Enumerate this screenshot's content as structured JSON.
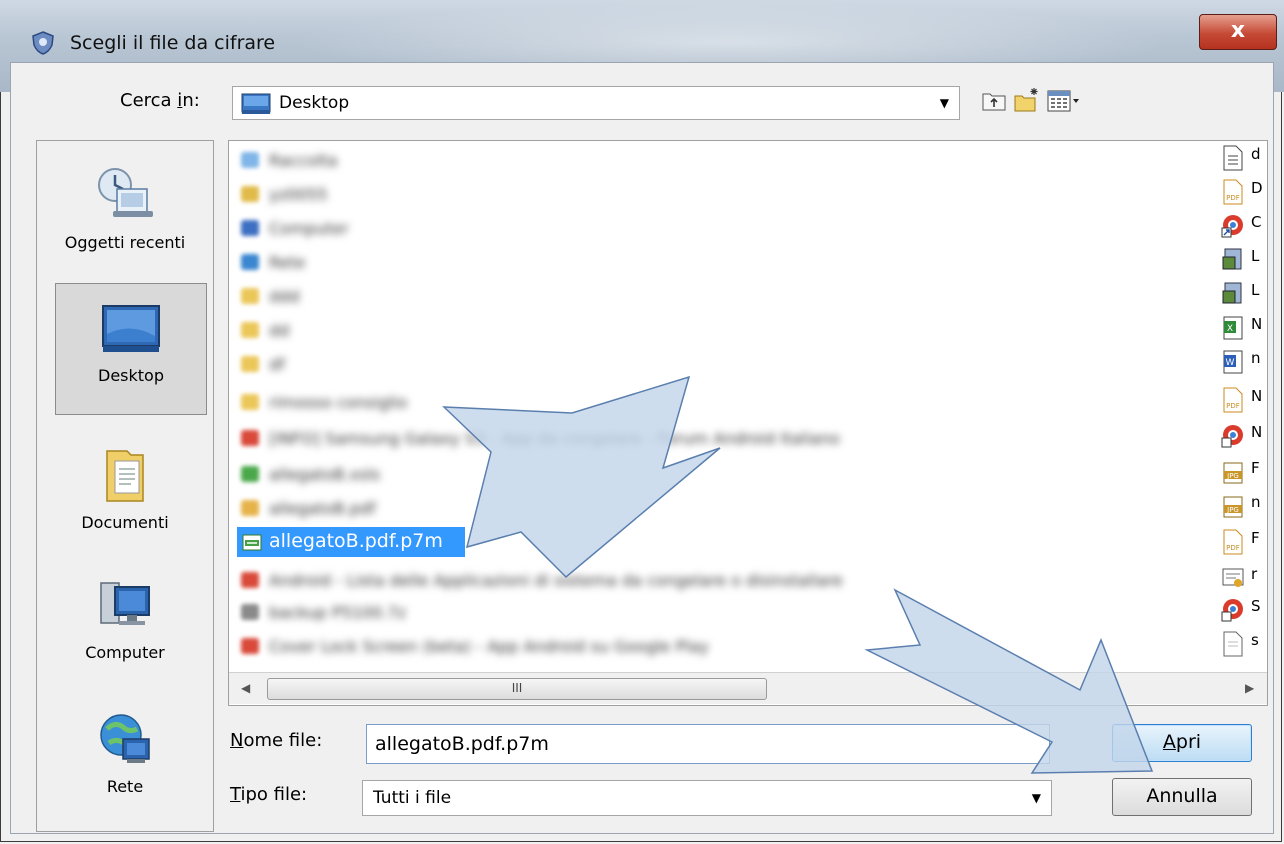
{
  "dialog": {
    "title": "Scegli il file da cifrare",
    "close_symbol": "x"
  },
  "lookin": {
    "label_pre": "Cerca ",
    "label_accel": "i",
    "label_post": "n:",
    "value": "Desktop"
  },
  "places": [
    {
      "label": "Oggetti recenti",
      "icon": "recent-items-icon"
    },
    {
      "label": "Desktop",
      "icon": "desktop-icon",
      "selected": true
    },
    {
      "label": "Documenti",
      "icon": "documents-folder-icon"
    },
    {
      "label": "Computer",
      "icon": "computer-icon"
    },
    {
      "label": "Rete",
      "icon": "network-icon"
    }
  ],
  "files": {
    "selected": "allegatoB.pdf.p7m",
    "blurred_rows": [
      "Raccolta",
      "yz0055",
      "Computer",
      "Rete",
      "ddd",
      "dd",
      "df",
      "rimosso consiglio",
      "[INFO] Samsung Galaxy S3 - App da congelare - Forum Android Italiano",
      "allegatoB.xsls",
      "allegatoB.pdf",
      "Android - Lista delle Applicazioni di sistema da congelare o disinstallare",
      "backup P5100.7z",
      "Cover Lock Screen (beta) - App Android su Google Play"
    ],
    "right_column_chars": [
      "d",
      "D",
      "C",
      "L",
      "L",
      "N",
      "n",
      "N",
      "N",
      "F",
      "n",
      "F",
      "r",
      "S",
      "s"
    ]
  },
  "scrollbar": {
    "grip": "III"
  },
  "filename": {
    "label_accel": "N",
    "label_rest": "ome file:",
    "value": "allegatoB.pdf.p7m"
  },
  "filetype": {
    "label_accel": "T",
    "label_rest": "ipo file:",
    "value": "Tutti i file"
  },
  "buttons": {
    "open_accel": "A",
    "open_rest": "pri",
    "cancel": "Annulla"
  },
  "colors": {
    "selection": "#3399ff",
    "arrow_fill": "#c2d5ea",
    "arrow_stroke": "#5a7fae"
  }
}
